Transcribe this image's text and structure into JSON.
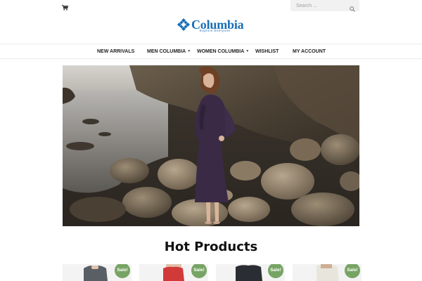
{
  "header": {
    "search": {
      "placeholder": "Search ..."
    },
    "logo": {
      "name": "Columbia",
      "tagline": "Explore Everyone"
    }
  },
  "nav": {
    "items": [
      {
        "label": "NEW ARRIVALS",
        "has_dropdown": false
      },
      {
        "label": "MEN COLUMBIA",
        "has_dropdown": true
      },
      {
        "label": "WOMEN COLUMBIA",
        "has_dropdown": true
      },
      {
        "label": "WISHLIST",
        "has_dropdown": false
      },
      {
        "label": "MY ACCOUNT",
        "has_dropdown": false
      }
    ]
  },
  "section": {
    "title": "Hot Products"
  },
  "products": [
    {
      "badge": "Sale!",
      "garment_color": "#5a5f66"
    },
    {
      "badge": "Sale!",
      "garment_color": "#d23a3a"
    },
    {
      "badge": "Sale!",
      "garment_color": "#2a2d33"
    },
    {
      "badge": "Sale!",
      "garment_color": "#e8e6dc"
    }
  ],
  "colors": {
    "accent": "#1a6eb5",
    "sale_badge": "#77a464"
  },
  "icons": {
    "cart": "shopping-cart-icon",
    "search": "magnifier-icon",
    "logo_mark": "diamond-logo-icon"
  }
}
